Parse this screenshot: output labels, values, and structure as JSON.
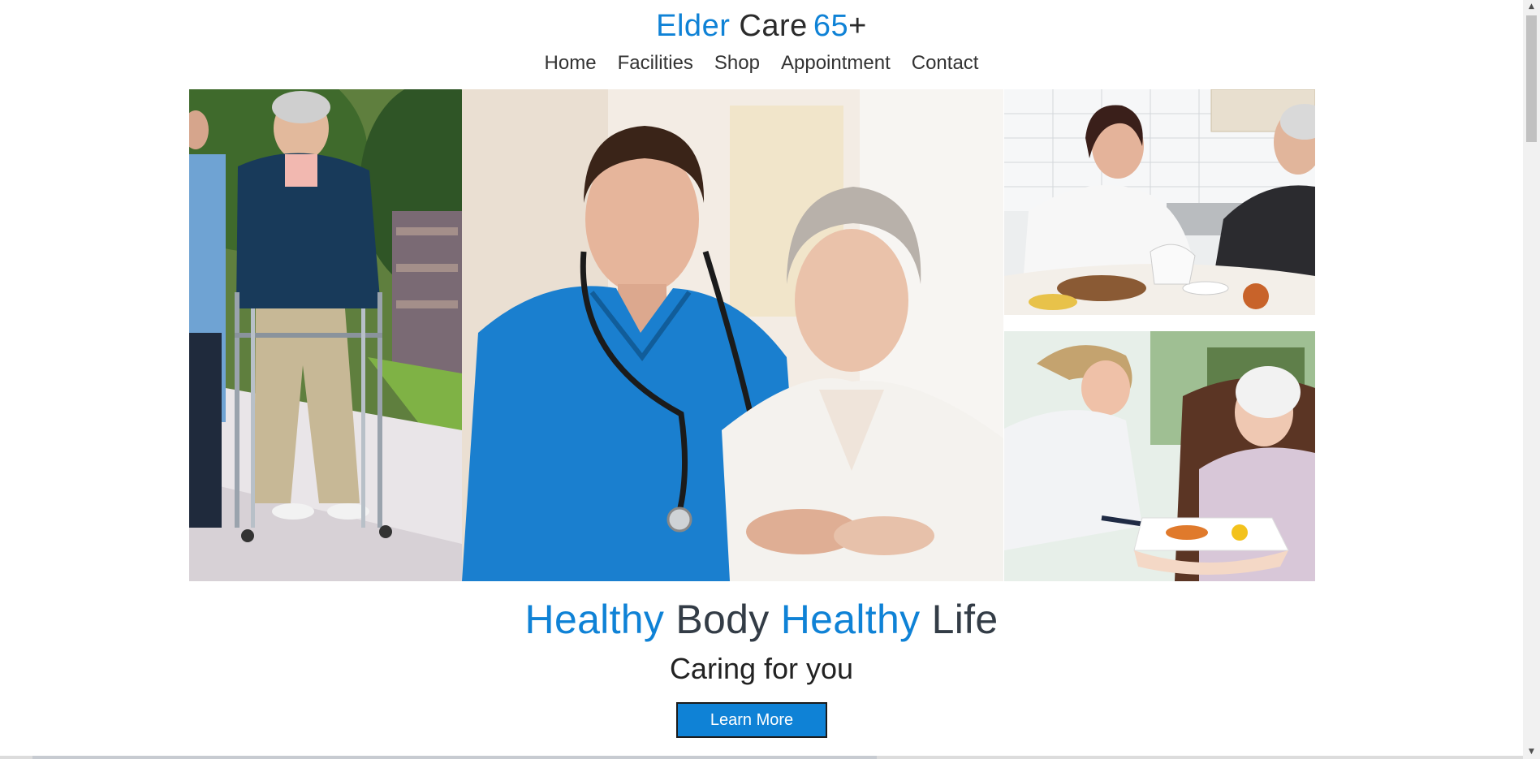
{
  "site": {
    "brand_word1": "Elder",
    "brand_word2": "Care",
    "brand_word3": "65",
    "brand_word4": "+"
  },
  "nav": {
    "items": [
      {
        "label": "Home"
      },
      {
        "label": "Facilities"
      },
      {
        "label": "Shop"
      },
      {
        "label": "Appointment"
      },
      {
        "label": "Contact"
      }
    ]
  },
  "hero": {
    "headline_word1": "Healthy",
    "headline_word2": "Body",
    "headline_word3": "Healthy",
    "headline_word4": "Life",
    "subheading": "Caring for you",
    "cta_label": "Learn More"
  },
  "colors": {
    "accent": "#0f82d6",
    "text": "#2b2b2b",
    "background": "#ffffff"
  },
  "icons": {
    "scroll_up": "scroll-up-arrow-icon",
    "scroll_down": "scroll-down-arrow-icon"
  }
}
